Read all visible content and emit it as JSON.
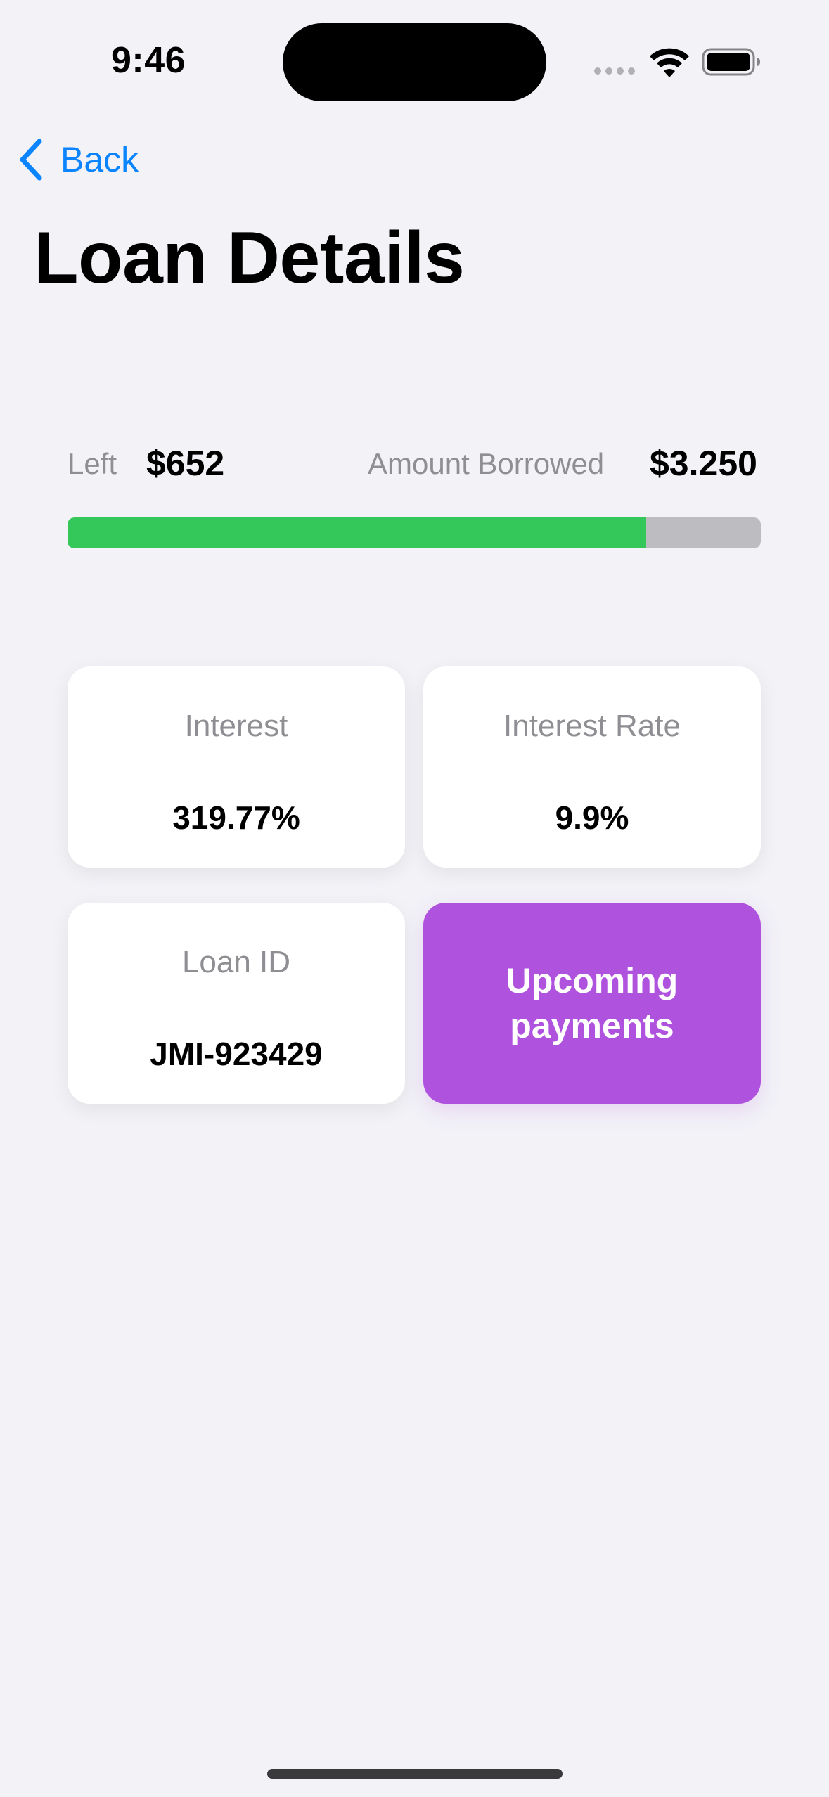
{
  "status_bar": {
    "time": "9:46"
  },
  "nav": {
    "back_label": "Back"
  },
  "page": {
    "title": "Loan Details"
  },
  "summary": {
    "left_label": "Left",
    "left_value": "$652",
    "borrowed_label": "Amount Borrowed",
    "borrowed_value": "$3.250",
    "progress_fraction": 0.835
  },
  "cards": [
    {
      "label": "Interest",
      "value": "319.77%"
    },
    {
      "label": "Interest Rate",
      "value": "9.9%"
    },
    {
      "label": "Loan ID",
      "value": "JMI-923429"
    }
  ],
  "action": {
    "label": "Upcoming payments"
  },
  "colors": {
    "accent": "#0a84ff",
    "progress_fill": "#34c759",
    "progress_track": "#bcbcc1",
    "action_button": "#af52de",
    "background": "#f2f2f7"
  }
}
